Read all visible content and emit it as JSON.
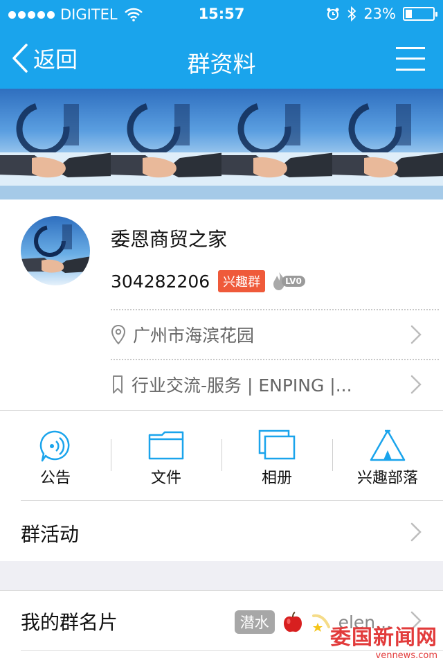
{
  "status_bar": {
    "carrier": "DIGITEL",
    "time": "15:57",
    "battery_percent": "23%",
    "battery_level": 0.23
  },
  "nav": {
    "back_label": "返回",
    "title": "群资料",
    "menu_icon": "hamburger-menu-icon"
  },
  "group": {
    "name": "委恩商贸之家",
    "id": "304282206",
    "tag": "兴趣群",
    "level": "LV0",
    "location": "广州市海滨花园",
    "category": "行业交流-服务 | ENPING |..."
  },
  "actions": [
    {
      "label": "公告",
      "icon": "announcement-icon"
    },
    {
      "label": "文件",
      "icon": "folder-icon"
    },
    {
      "label": "相册",
      "icon": "album-icon"
    },
    {
      "label": "兴趣部落",
      "icon": "tent-icon"
    }
  ],
  "rows": {
    "activities": "群活动",
    "my_card": "我的群名片",
    "my_card_role": "潜水",
    "my_card_nick": "elen..."
  },
  "watermark": {
    "cn": "委国新闻网",
    "en": "vennews.com"
  },
  "colors": {
    "header_blue": "#1aa4ec",
    "tag_red": "#ef5a3a",
    "icon_blue": "#1aa4ec"
  }
}
